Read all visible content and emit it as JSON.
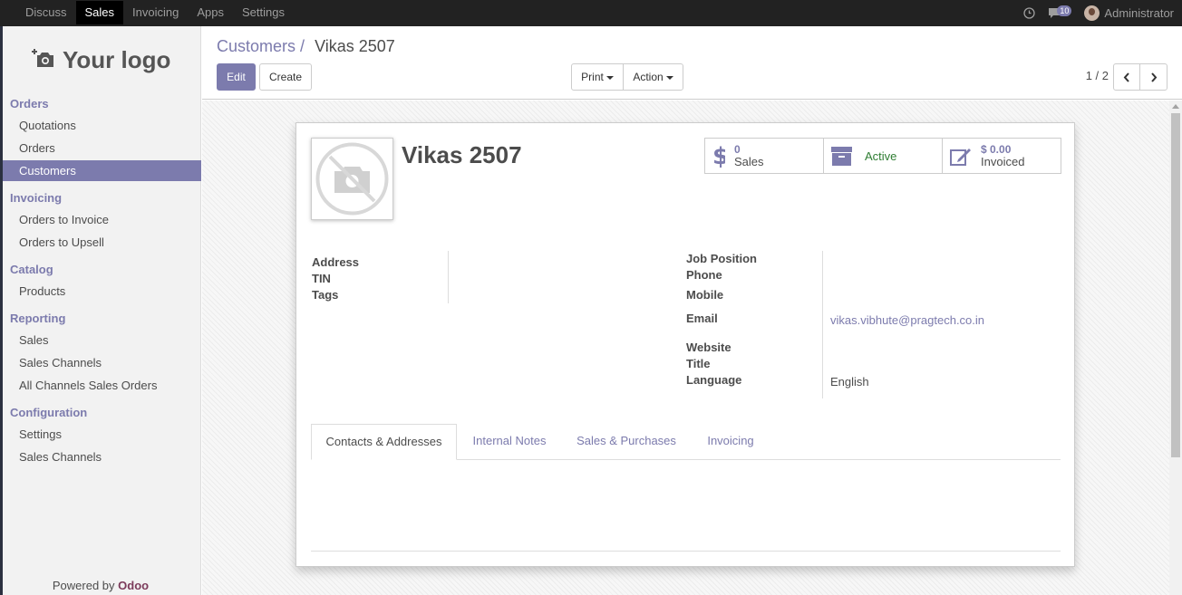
{
  "topnav": {
    "menu": [
      "Discuss",
      "Sales",
      "Invoicing",
      "Apps",
      "Settings"
    ],
    "active": "Sales",
    "message_count": "10",
    "user": "Administrator"
  },
  "sidebar": {
    "logo_text": "Your logo",
    "sections": [
      {
        "title": "Orders",
        "items": [
          "Quotations",
          "Orders",
          "Customers"
        ]
      },
      {
        "title": "Invoicing",
        "items": [
          "Orders to Invoice",
          "Orders to Upsell"
        ]
      },
      {
        "title": "Catalog",
        "items": [
          "Products"
        ]
      },
      {
        "title": "Reporting",
        "items": [
          "Sales",
          "Sales Channels",
          "All Channels Sales Orders"
        ]
      },
      {
        "title": "Configuration",
        "items": [
          "Settings",
          "Sales Channels"
        ]
      }
    ],
    "active_item": "Customers",
    "powered_prefix": "Powered by",
    "powered_brand": "Odoo"
  },
  "control_panel": {
    "breadcrumb_parent": "Customers",
    "breadcrumb_separator": "/",
    "breadcrumb_current": "Vikas 2507",
    "edit_label": "Edit",
    "create_label": "Create",
    "print_label": "Print",
    "action_label": "Action",
    "pager": "1 / 2"
  },
  "record": {
    "name": "Vikas 2507",
    "smart_buttons": {
      "sales_count": "0",
      "sales_label": "Sales",
      "active_label": "Active",
      "invoiced_amount": "$ 0.00",
      "invoiced_label": "Invoiced"
    },
    "left_fields": {
      "address_label": "Address",
      "tin_label": "TIN",
      "tags_label": "Tags"
    },
    "right_fields": {
      "job_position_label": "Job Position",
      "phone_label": "Phone",
      "mobile_label": "Mobile",
      "email_label": "Email",
      "email_value": "vikas.vibhute@pragtech.co.in",
      "website_label": "Website",
      "title_label": "Title",
      "language_label": "Language",
      "language_value": "English"
    },
    "tabs": [
      "Contacts & Addresses",
      "Internal Notes",
      "Sales & Purchases",
      "Invoicing"
    ],
    "active_tab": "Contacts & Addresses"
  },
  "colors": {
    "accent": "#7c7bad",
    "topbar": "#222222",
    "active_status": "#2e7d32"
  }
}
